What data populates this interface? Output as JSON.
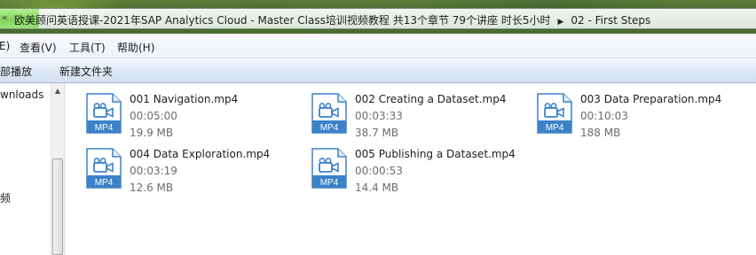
{
  "address": {
    "back_chevron": "«",
    "path_segments": [
      "欧美顾问英语授课-2021年SAP Analytics Cloud - Master Class培训视频教程 共13个章节 79个讲座 时长5小时",
      "02 - First Steps"
    ],
    "separator": "▶",
    "accent_color": "#7fd35a"
  },
  "menubar": {
    "items": [
      "E)",
      "查看(V)",
      "工具(T)",
      "帮助(H)"
    ]
  },
  "toolbar": {
    "items": [
      "部播放",
      "新建文件夹"
    ]
  },
  "navigation": {
    "items": [
      "wnloads",
      "频"
    ]
  },
  "files": [
    {
      "name": "001 Navigation.mp4",
      "duration": "00:05:00",
      "size": "19.9 MB",
      "icon": "video-file-icon",
      "badge": "MP4"
    },
    {
      "name": "002 Creating a Dataset.mp4",
      "duration": "00:03:33",
      "size": "38.7 MB",
      "icon": "video-file-icon",
      "badge": "MP4"
    },
    {
      "name": "003 Data Preparation.mp4",
      "duration": "00:10:03",
      "size": "188 MB",
      "icon": "video-file-icon",
      "badge": "MP4"
    },
    {
      "name": "004 Data Exploration.mp4",
      "duration": "00:03:19",
      "size": "12.6 MB",
      "icon": "video-file-icon",
      "badge": "MP4"
    },
    {
      "name": "005 Publishing a Dataset.mp4",
      "duration": "00:00:53",
      "size": "14.4 MB",
      "icon": "video-file-icon",
      "badge": "MP4"
    }
  ],
  "colors": {
    "icon_blue": "#3d82c9",
    "metadata_gray": "#6d6d6d"
  }
}
